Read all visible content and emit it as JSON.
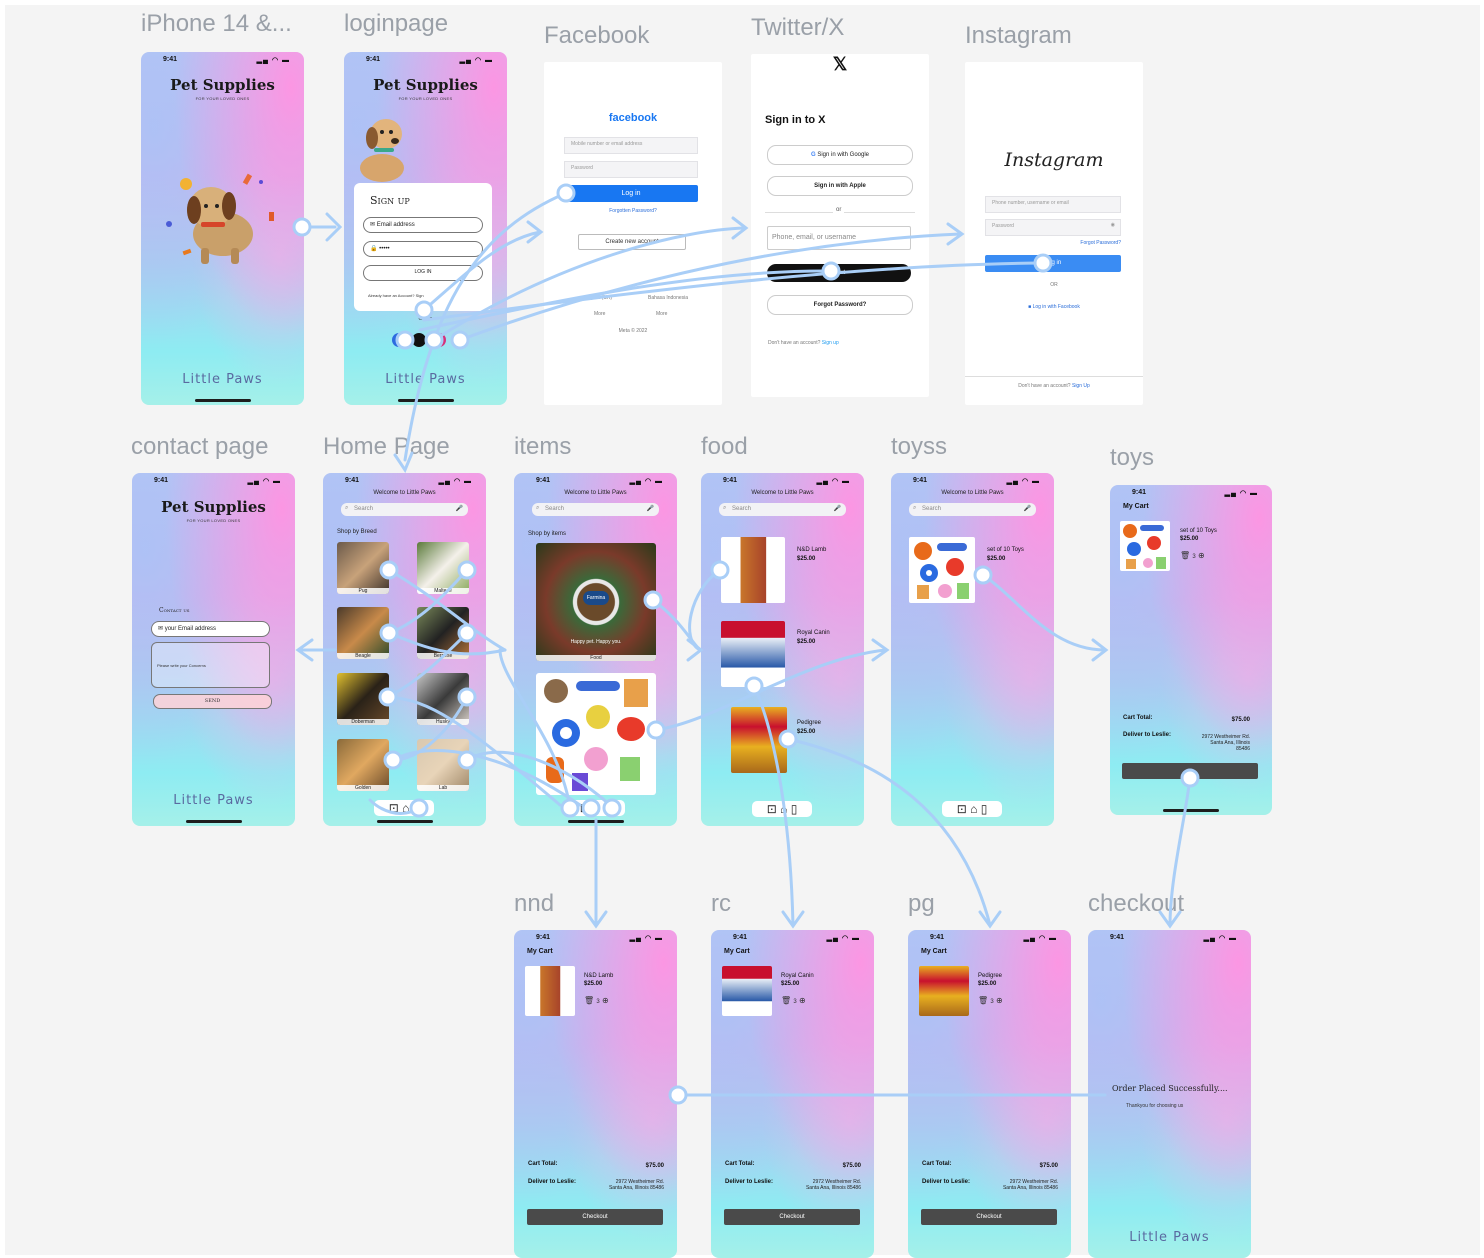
{
  "frames": {
    "iphone": {
      "label": "iPhone 14 &...",
      "time": "9:41",
      "title": "Pet Supplies",
      "subtitle": "FOR YOUR LOVED ONES",
      "brand": "Little Paws"
    },
    "login": {
      "label": "loginpage",
      "time": "9:41",
      "title": "Pet Supplies",
      "subtitle": "FOR YOUR LOVED ONES",
      "signup": "Sign up",
      "email_placeholder": "Email address",
      "password_value": "•••••",
      "login_btn": "LOG IN",
      "already": "Already have an Account? Sign",
      "or": "Or Via",
      "brand": "Little Paws"
    },
    "facebook": {
      "label": "Facebook",
      "logo": "facebook",
      "mobile_placeholder": "Mobile number or email address",
      "password_placeholder": "Password",
      "login_btn": "Log in",
      "forgot": "Forgotten Password?",
      "create": "Create new account",
      "lang_1": "English (UK)",
      "lang_2": "Bahasa Indonesia",
      "more_1": "More",
      "more_2": "More",
      "meta": "Meta © 2022"
    },
    "twitter": {
      "label": "Twitter/X",
      "logo": "𝕏",
      "heading": "Sign in to X",
      "google": "Sign in with Google",
      "apple": "Sign in with Apple",
      "or": "or",
      "phone_placeholder": "Phone, email, or username",
      "next": "Next",
      "forgot": "Forgot Password?",
      "noacc": "Don't have an account?",
      "signup": "Sign up"
    },
    "instagram": {
      "label": "Instagram",
      "logo": "Instagram",
      "user_placeholder": "Phone number, username or email",
      "password_placeholder": "Password",
      "forgot": "Forgot Password?",
      "login_btn": "Log in",
      "or": "OR",
      "fb": "Log in with Facebook",
      "noacc": "Don't have an account?",
      "signup": "Sign Up"
    },
    "contact": {
      "label": "contact page",
      "time": "9:41",
      "title": "Pet Supplies",
      "subtitle": "FOR YOUR LOVED ONES",
      "heading": "Contact us",
      "email_placeholder": "your Email address",
      "concern_placeholder": "Please write your Concerns",
      "send": "SEND",
      "brand": "Little Paws"
    },
    "home": {
      "label": "Home Page",
      "time": "9:41",
      "welcome": "Welcome to Little Paws",
      "search": "Search",
      "section": "Shop by Breed",
      "breeds": [
        "Pug",
        "Maltese",
        "Beagle",
        "Bernese",
        "Doberman",
        "Husky",
        "Golden",
        "Lab"
      ]
    },
    "items": {
      "label": "items",
      "time": "9:41",
      "welcome": "Welcome to Little Paws",
      "search": "Search",
      "section": "Shop by items",
      "food": "Food",
      "bowl": "Farmina",
      "tagline": "Happy pet. Happy you."
    },
    "food": {
      "label": "food",
      "time": "9:41",
      "welcome": "Welcome to Little Paws",
      "search": "Search",
      "products": [
        {
          "name": "N&D Lamb",
          "price": "$25.00"
        },
        {
          "name": "Royal Canin",
          "price": "$25.00"
        },
        {
          "name": "Pedigree",
          "price": "$25.00"
        }
      ]
    },
    "toyss": {
      "label": "toyss",
      "time": "9:41",
      "welcome": "Welcome to Little Paws",
      "search": "Search",
      "product": {
        "name": "set of 10 Toys",
        "price": "$25.00"
      }
    },
    "toys": {
      "label": "toys",
      "time": "9:41",
      "cart": "My Cart",
      "product": {
        "name": "set of 10 Toys",
        "price": "$25.00"
      },
      "qty": "3",
      "cart_total_label": "Cart Total:",
      "cart_total": "$75.00",
      "deliver": "Deliver to Leslie:",
      "address": "2972 Westheimer Rd. Santa Ana, Illinois 85486"
    },
    "nnd": {
      "label": "nnd",
      "time": "9:41",
      "cart": "My Cart",
      "product": {
        "name": "N&D Lamb",
        "price": "$25.00"
      },
      "qty": "3",
      "cart_total_label": "Cart Total:",
      "cart_total": "$75.00",
      "deliver": "Deliver to Leslie:",
      "address": "2972 Westheimer Rd. Santa Ana, Illinois 85486",
      "checkout": "Checkout"
    },
    "rc": {
      "label": "rc",
      "time": "9:41",
      "cart": "My Cart",
      "product": {
        "name": "Royal Canin",
        "price": "$25.00"
      },
      "qty": "3",
      "cart_total_label": "Cart Total:",
      "cart_total": "$75.00",
      "deliver": "Deliver to Leslie:",
      "address": "2972 Westheimer Rd. Santa Ana, Illinois 85486",
      "checkout": "Checkout"
    },
    "pg": {
      "label": "pg",
      "time": "9:41",
      "cart": "My Cart",
      "product": {
        "name": "Pedigree",
        "price": "$25.00"
      },
      "qty": "3",
      "cart_total_label": "Cart Total:",
      "cart_total": "$75.00",
      "deliver": "Deliver to Leslie:",
      "address": "2972 Westheimer Rd. Santa Ana, Illinois 85486",
      "checkout": "Checkout"
    },
    "checkout": {
      "label": "checkout",
      "time": "9:41",
      "message": "Order Placed Successfully....",
      "thanks": "Thankyou for choosing us",
      "brand": "Little Paws"
    }
  },
  "colors": {
    "canvas": "#f4f4f4",
    "connector": "#a9cef7",
    "label": "#9aa0a8",
    "checkout_btn": "#4a4a4a",
    "fb_blue": "#1877f2"
  }
}
